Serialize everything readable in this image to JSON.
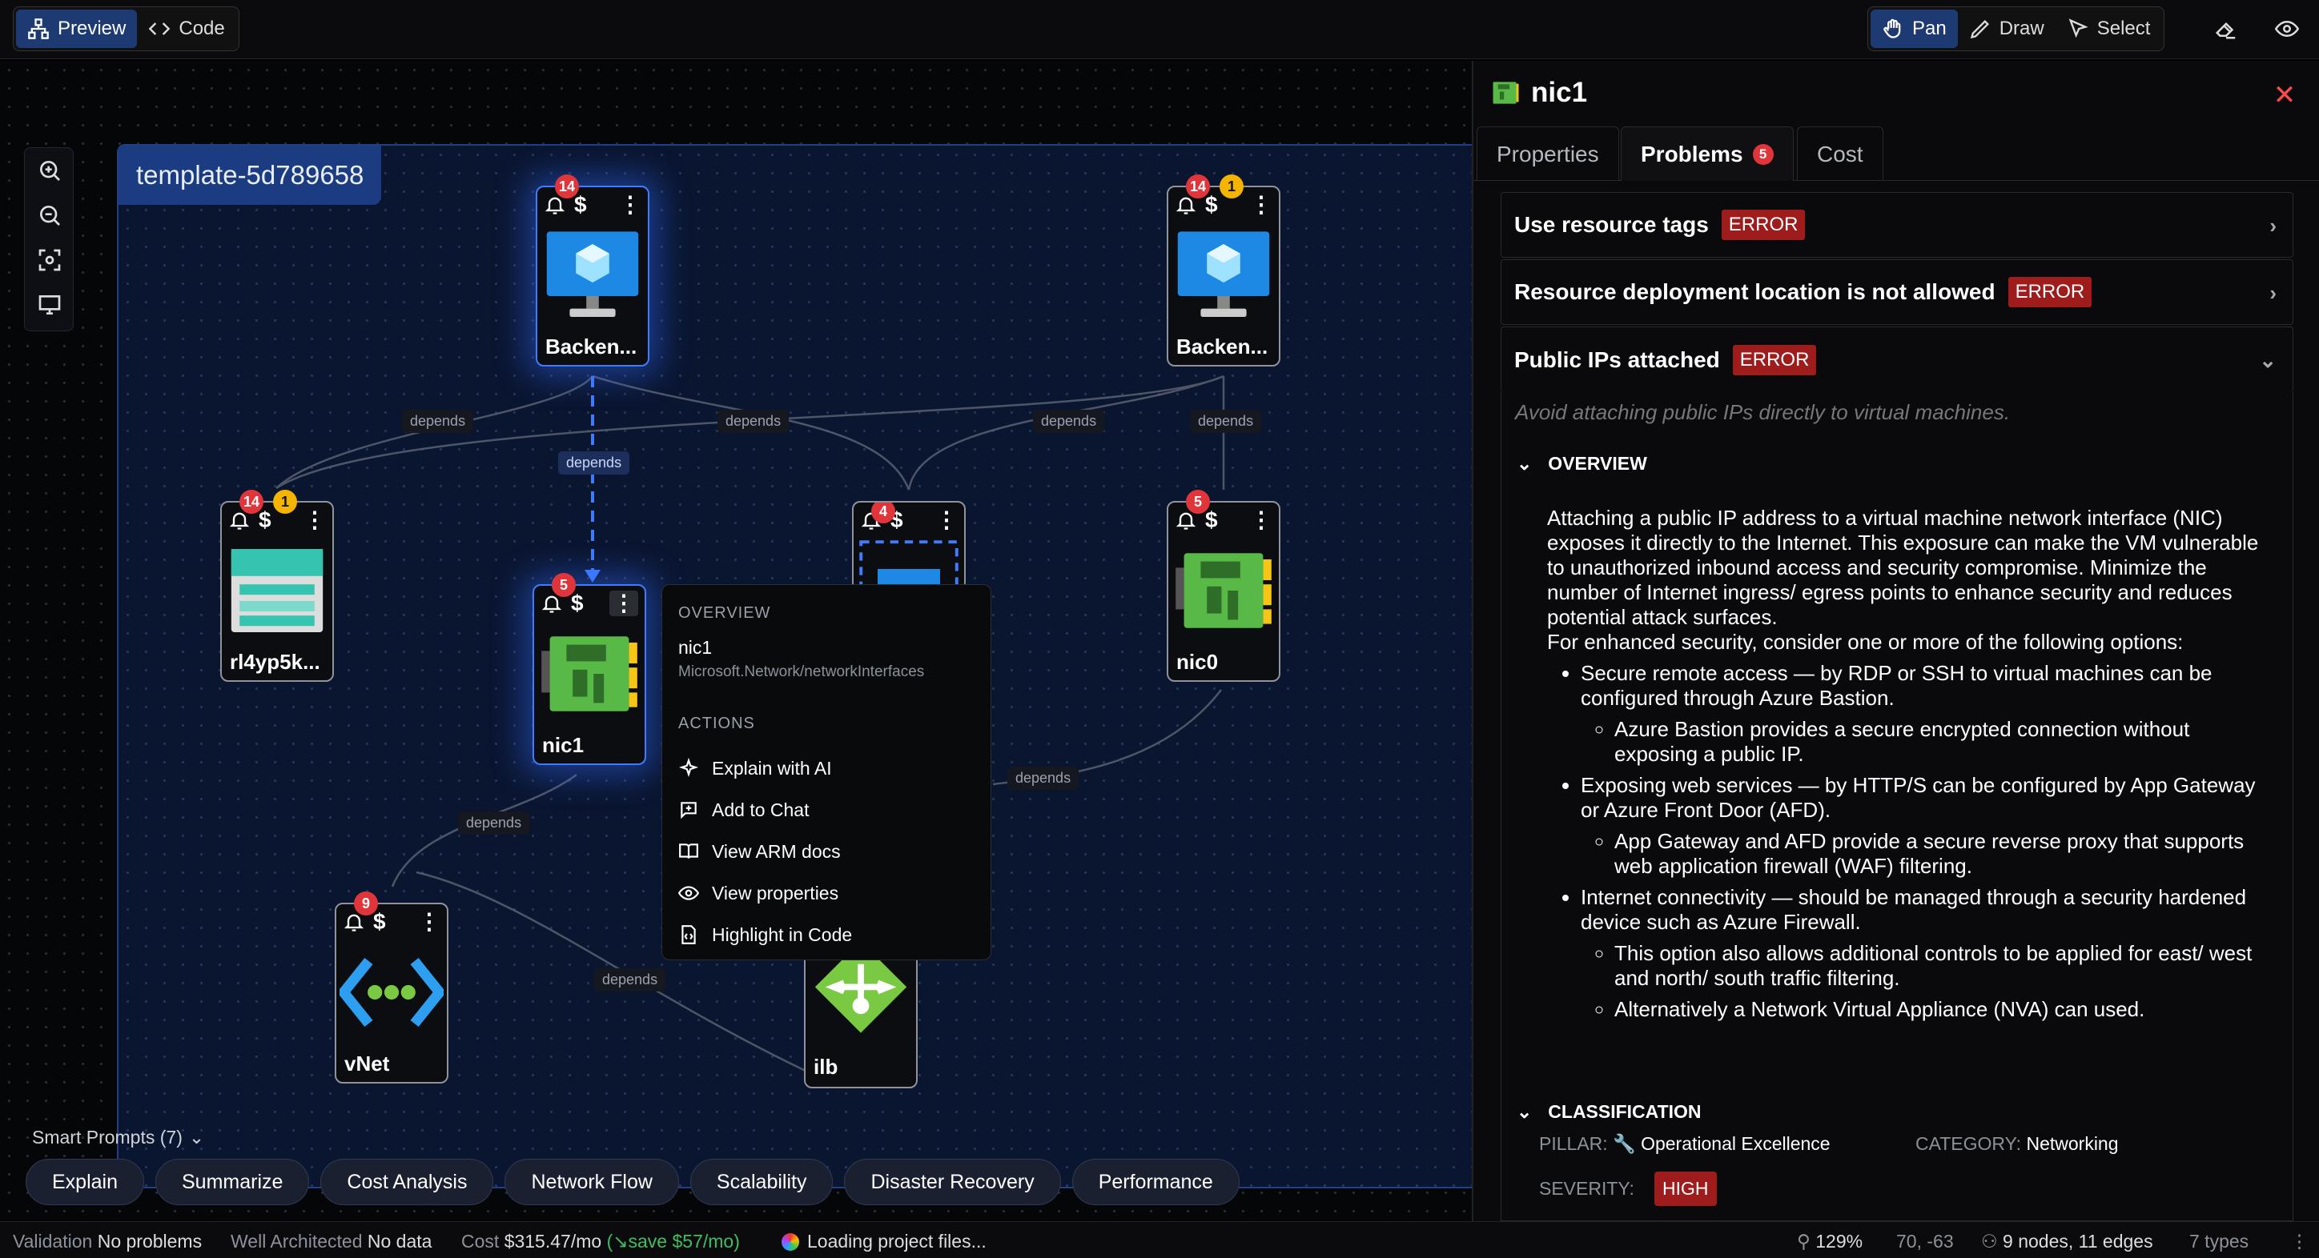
{
  "toolbar": {
    "view_modes": [
      {
        "label": "Preview",
        "icon": "diagram-icon"
      },
      {
        "label": "Code",
        "icon": "code-icon"
      }
    ],
    "tools": [
      {
        "label": "Pan",
        "icon": "hand-icon"
      },
      {
        "label": "Draw",
        "icon": "pen-icon"
      },
      {
        "label": "Select",
        "icon": "cursor-icon"
      }
    ],
    "extra_icons": [
      "eraser-icon",
      "eye-icon"
    ]
  },
  "canvas": {
    "group_title": "template-5d789658",
    "zoom_tools": [
      "zoom-in-icon",
      "zoom-out-icon",
      "fit-view-icon",
      "monitor-icon"
    ],
    "edge_label": "depends",
    "nodes": [
      {
        "id": "backend1",
        "name": "Backen...",
        "type": "vm",
        "alerts": "14",
        "warnings": ""
      },
      {
        "id": "backend2",
        "name": "Backen...",
        "type": "vm",
        "alerts": "14",
        "warnings": "1"
      },
      {
        "id": "rl4",
        "name": "rl4yp5k...",
        "type": "storage",
        "alerts": "14",
        "warnings": "1"
      },
      {
        "id": "nic1",
        "name": "nic1",
        "type": "nic",
        "alerts": "5",
        "warnings": ""
      },
      {
        "id": "mid",
        "name": "",
        "type": "subnet",
        "alerts": "4",
        "warnings": ""
      },
      {
        "id": "nic0",
        "name": "nic0",
        "type": "nic",
        "alerts": "5",
        "warnings": ""
      },
      {
        "id": "vnet",
        "name": "vNet",
        "type": "vnet",
        "alerts": "9",
        "warnings": ""
      },
      {
        "id": "ilb",
        "name": "ilb",
        "type": "lb",
        "alerts": "",
        "warnings": ""
      }
    ]
  },
  "context_menu": {
    "overview_label": "OVERVIEW",
    "resource_name": "nic1",
    "resource_type": "Microsoft.Network/networkInterfaces",
    "actions_label": "ACTIONS",
    "actions": [
      "Explain with AI",
      "Add to Chat",
      "View ARM docs",
      "View properties",
      "Highlight in Code"
    ]
  },
  "smart_prompts": {
    "label": "Smart Prompts (7)",
    "chips": [
      "Explain",
      "Summarize",
      "Cost Analysis",
      "Network Flow",
      "Scalability",
      "Disaster Recovery",
      "Performance"
    ]
  },
  "panel": {
    "title": "nic1",
    "tabs": [
      {
        "label": "Properties"
      },
      {
        "label": "Problems",
        "count": "5"
      },
      {
        "label": "Cost"
      }
    ],
    "problems": [
      {
        "title": "Use resource tags",
        "level": "ERROR"
      },
      {
        "title": "Resource deployment location is not allowed",
        "level": "ERROR"
      },
      {
        "title": "Public IPs attached",
        "level": "ERROR"
      }
    ],
    "description": "Avoid attaching public IPs directly to virtual machines.",
    "overview_label": "OVERVIEW",
    "overview_p1": "Attaching a public IP address to a virtual machine network interface (NIC) exposes it directly to the Internet. This exposure can make the VM vulnerable to unauthorized inbound access and security compromise. Minimize the number of Internet ingress/ egress points to enhance security and reduces potential attack surfaces.",
    "overview_p2": "For enhanced security, consider one or more of the following options:",
    "bullets": [
      {
        "text": "Secure remote access — by RDP or SSH to virtual machines can be configured through Azure Bastion.",
        "sub": [
          "Azure Bastion provides a secure encrypted connection without exposing a public IP."
        ]
      },
      {
        "text": "Exposing web services — by HTTP/S can be configured by App Gateway or Azure Front Door (AFD).",
        "sub": [
          "App Gateway and AFD provide a secure reverse proxy that supports web application firewall (WAF) filtering."
        ]
      },
      {
        "text": "Internet connectivity — should be managed through a security hardened device such as Azure Firewall.",
        "sub": [
          "This option also allows additional controls to be applied for east/ west and north/ south traffic filtering.",
          "Alternatively a Network Virtual Appliance (NVA) can used."
        ]
      }
    ],
    "classification_label": "CLASSIFICATION",
    "pillar_label": "PILLAR:",
    "pillar_value": "Operational Excellence",
    "category_label": "CATEGORY:",
    "category_value": "Networking",
    "severity_label": "SEVERITY:",
    "severity_value": "HIGH"
  },
  "status": {
    "validation_label": "Validation",
    "validation_value": "No problems",
    "wa_label": "Well Architected",
    "wa_value": "No data",
    "cost_label": "Cost",
    "cost_value": "$315.47/mo",
    "save_value": "save $57/mo)",
    "loading": "Loading project files...",
    "zoom": "129%",
    "coords": "70, -63",
    "graph": "9 nodes, 11 edges",
    "types": "7 types"
  },
  "colors": {
    "accent": "#3f7bff",
    "error": "#9e1c1c",
    "badge_red": "#e0353b",
    "badge_yellow": "#f5b400",
    "save_green": "#3fbf5f"
  }
}
